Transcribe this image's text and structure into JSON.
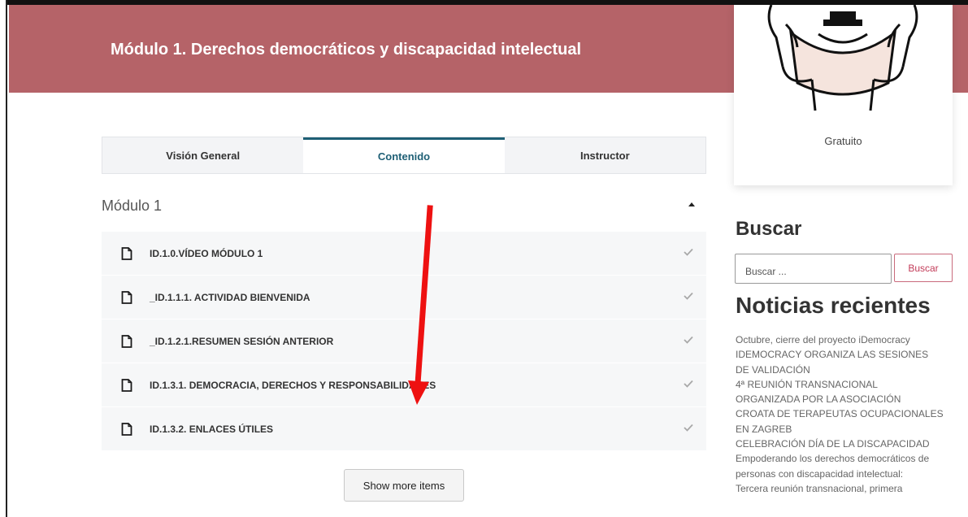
{
  "header": {
    "title": "Módulo 1. Derechos democráticos y discapacidad intelectual"
  },
  "course_card": {
    "price": "Gratuito"
  },
  "tabs": [
    {
      "label": "Visión General",
      "active": false
    },
    {
      "label": "Contenido",
      "active": true
    },
    {
      "label": "Instructor",
      "active": false
    }
  ],
  "module": {
    "title": "Módulo 1",
    "lessons": [
      {
        "label": "ID.1.0.VÍDEO MÓDULO 1",
        "icon": "document-icon",
        "status_icon": "check-icon"
      },
      {
        "label": "_ID.1.1.1. ACTIVIDAD BIENVENIDA",
        "icon": "document-icon",
        "status_icon": "check-icon"
      },
      {
        "label": "_ID.1.2.1.RESUMEN SESIÓN ANTERIOR",
        "icon": "document-icon",
        "status_icon": "check-icon"
      },
      {
        "label": "ID.1.3.1. DEMOCRACIA, DERECHOS Y RESPONSABILIDADES",
        "icon": "document-icon",
        "status_icon": "check-icon"
      },
      {
        "label": "ID.1.3.2. ENLACES ÚTILES",
        "icon": "document-icon",
        "status_icon": "check-icon"
      }
    ],
    "show_more_label": "Show more items"
  },
  "sidebar": {
    "search_heading": "Buscar",
    "search_placeholder": "Buscar ...",
    "search_button": "Buscar",
    "news_heading": "Noticias recientes",
    "news_lines": [
      "Octubre, cierre del proyecto iDemocracy",
      "IDEMOCRACY ORGANIZA LAS SESIONES",
      "DE VALIDACIÓN",
      "4ª REUNIÓN TRANSNACIONAL",
      "ORGANIZADA POR LA ASOCIACIÓN",
      "CROATA DE TERAPEUTAS OCUPACIONALES",
      "EN ZAGREB",
      "CELEBRACIÓN DÍA DE LA DISCAPACIDAD",
      "Empoderando los derechos democráticos de",
      "personas con discapacidad intelectual:",
      "Tercera reunión transnacional, primera"
    ]
  },
  "colors": {
    "hero_bg": "#b56368",
    "tab_active_accent": "#1e5f75",
    "search_button": "#c23b58",
    "annotation_arrow": "#ee1111"
  }
}
